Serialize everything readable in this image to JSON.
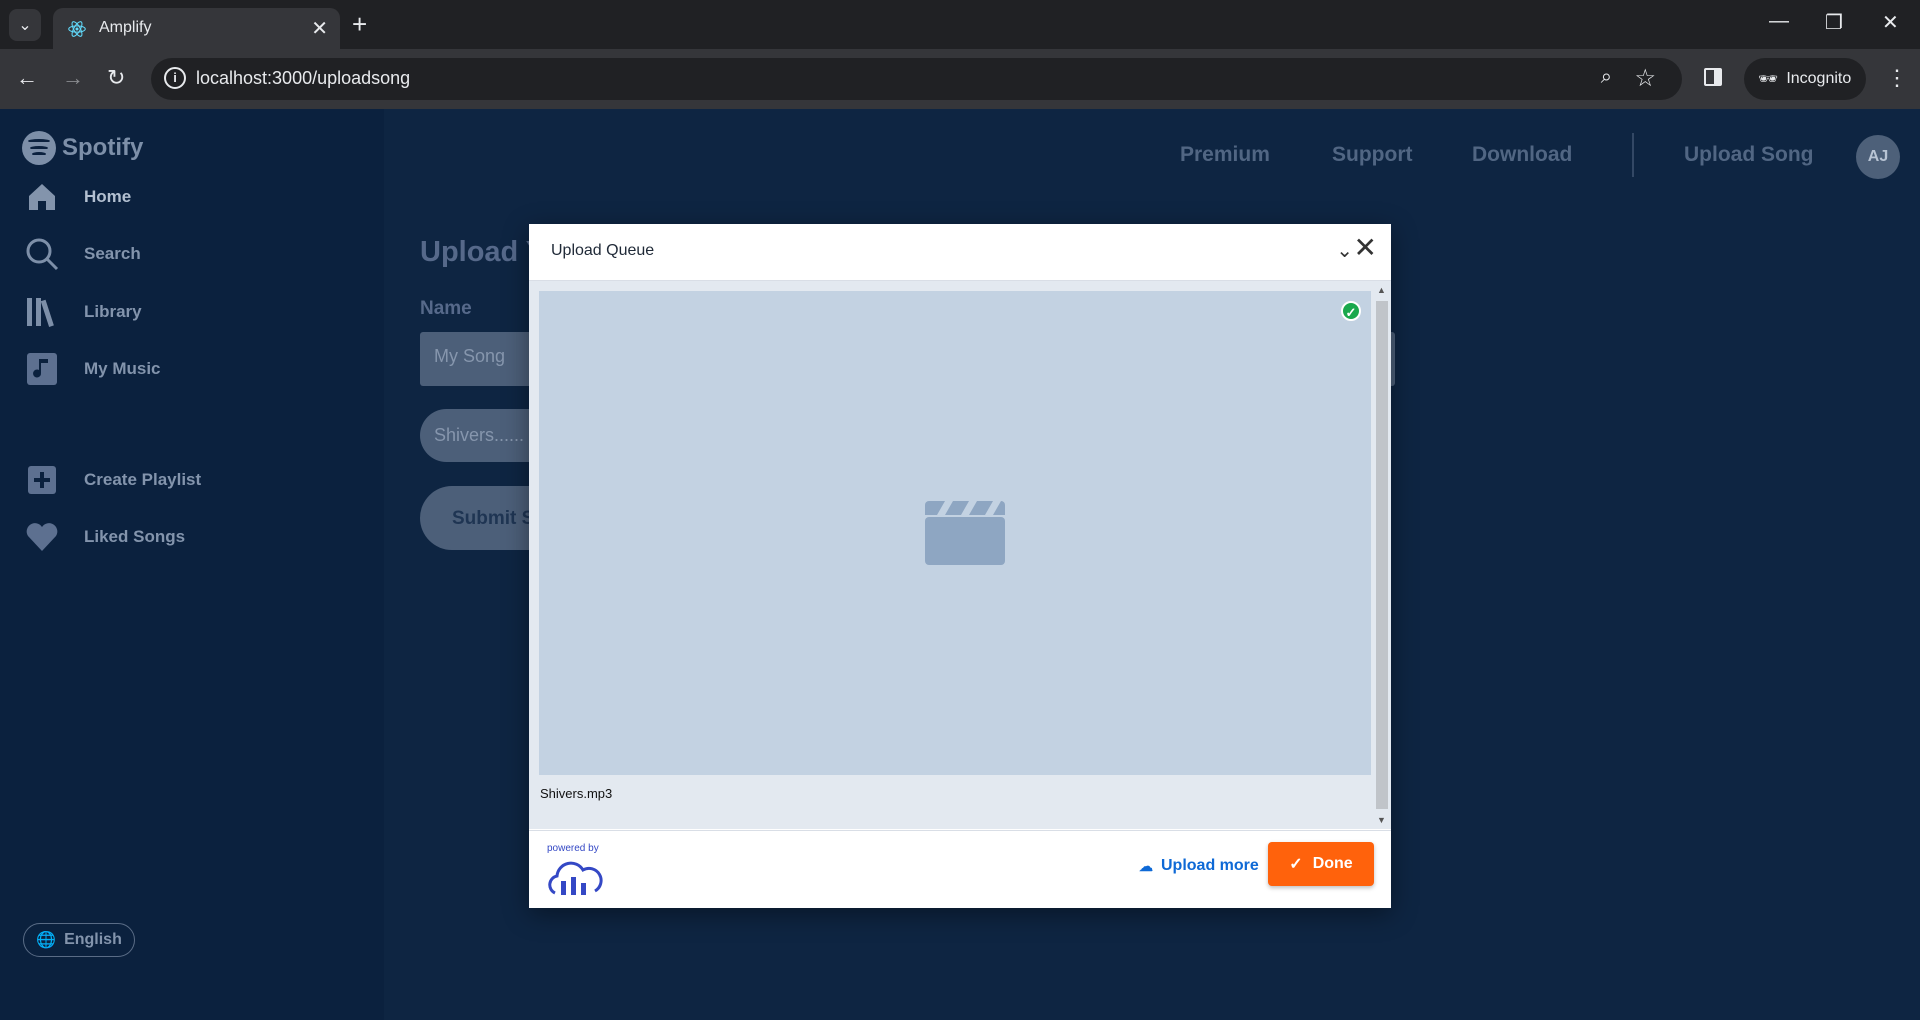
{
  "browser": {
    "tab_title": "Amplify",
    "url": "localhost:3000/uploadsong",
    "incognito_label": "Incognito"
  },
  "sidebar": {
    "logo_text": "Spotify",
    "items": [
      {
        "label": "Home",
        "icon": "home-icon"
      },
      {
        "label": "Search",
        "icon": "search-icon"
      },
      {
        "label": "Library",
        "icon": "library-icon"
      },
      {
        "label": "My Music",
        "icon": "music-note-icon"
      },
      {
        "label": "Create Playlist",
        "icon": "plus-icon"
      },
      {
        "label": "Liked Songs",
        "icon": "heart-icon"
      }
    ],
    "language": "English"
  },
  "topnav": {
    "links": [
      "Premium",
      "Support",
      "Download"
    ],
    "upload_song": "Upload Song",
    "avatar_initials": "AJ"
  },
  "form": {
    "title": "Upload Y",
    "name_label": "Name",
    "name_value": "My Song",
    "file_label": "Shivers......",
    "submit_label": "Submit S"
  },
  "modal": {
    "title": "Upload Queue",
    "file_name": "Shivers.mp3",
    "powered_by": "powered by",
    "upload_more": "Upload more",
    "done": "Done",
    "accent_color": "#ff620c",
    "link_color": "#0e69d6"
  }
}
